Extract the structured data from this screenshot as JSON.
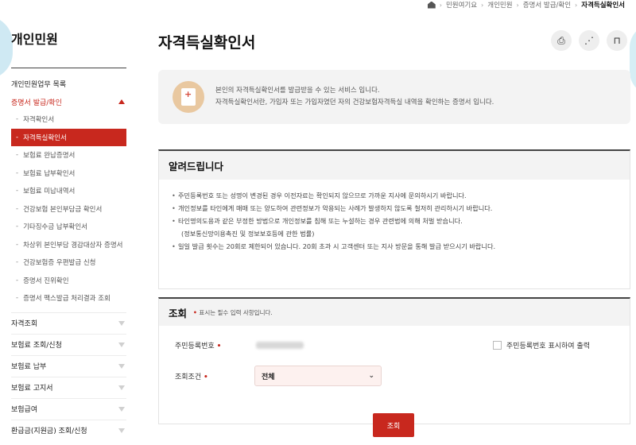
{
  "breadcrumb": [
    "민원여기요",
    "개인민원",
    "증명서 발급/확인",
    "자격득실확인서"
  ],
  "sidebar": {
    "title": "개인민원",
    "menu_head": "개인민원업무 목록",
    "open_category": "증명서 발급/확인",
    "sub_items": [
      "자격확인서",
      "자격득실확인서",
      "보험료 완납증명서",
      "보험료 납부확인서",
      "보험료 미납내역서",
      "건강보험 본인부담금 확인서",
      "기타징수금 납부확인서",
      "차상위 본인부담 경감대상자 증명서",
      "건강보험증 우편발급 신청",
      "증명서 진위확인",
      "증명서 팩스발급 처리결과 조회"
    ],
    "active_index": 1,
    "categories": [
      "자격조회",
      "보험료 조회/신청",
      "보험료 납부",
      "보험료 고지서",
      "보험급여",
      "환급금(지원금) 조회/신청"
    ]
  },
  "main": {
    "title": "자격득실확인서",
    "tools": {
      "print_icon": "print-icon",
      "share_icon": "share-icon",
      "bookmark_icon": "bookmark-icon"
    },
    "intro": {
      "line1": "본인의 자격득실확인서를 발급받을 수 있는 서비스 입니다.",
      "line2": "자격득실확인서란, 가입자 또는 가입자였던 자의 건강보험자격득실 내역을 확인하는 증명서 입니다."
    },
    "notice": {
      "heading": "알려드립니다",
      "items": [
        "주민등록번호 또는 성명이 변경된 경우 이전자료는 확인되지 않으므로 가까운 지사에 문의하시기 바랍니다.",
        "개인정보를 타인에게 매매 또는 양도하여 관련정보가 악용되는 사례가 발생하지 않도록 철저히 관리하시기 바랍니다.",
        "타인명의도용과 같은 부정한 방법으로 개인정보를 침해 또는 누설하는 경우 관련법에 의해 처벌 받습니다.",
        "일일 발급 횟수는 20회로 제한되어 있습니다. 20회 초과 시 고객센터 또는 지사 방문을 통해 발급 받으시기 바랍니다."
      ],
      "item3_cont": "(정보통신망이용촉진 및 정보보호등에 관한 법률)"
    },
    "query": {
      "heading": "조회",
      "required_note": "표시는 필수 입력 사항입니다.",
      "rrn_label": "주민등록번호",
      "condition_label": "조회조건",
      "condition_value": "전체",
      "print_rrn_label": "주민등록번호 표시하여 출력",
      "submit_label": "조회"
    }
  }
}
